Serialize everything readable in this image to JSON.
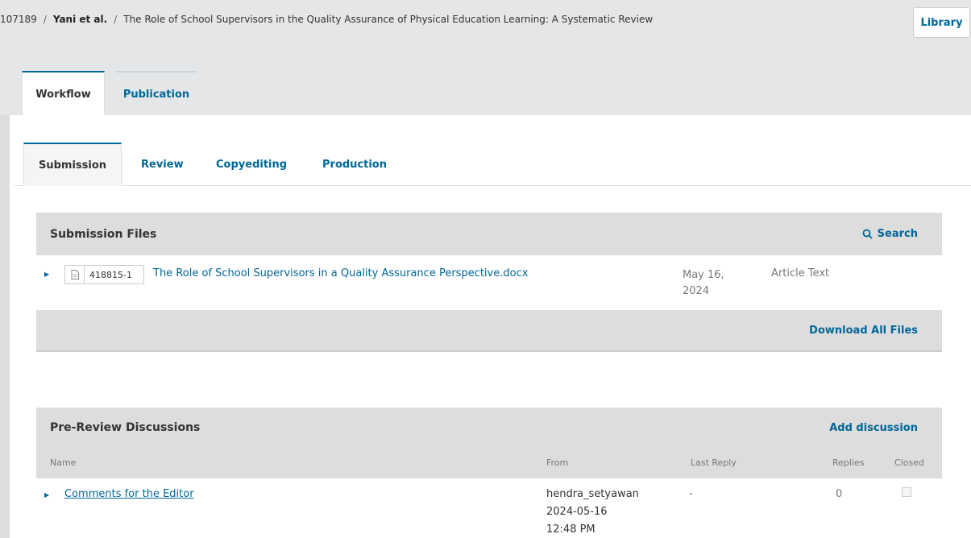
{
  "breadcrumb": {
    "id": "107189",
    "author": "Yani et al.",
    "title": "The Role of School Supervisors in the Quality Assurance of Physical Education Learning: A Systematic Review",
    "separator": "/"
  },
  "header": {
    "library_label": "Library"
  },
  "top_tabs": [
    {
      "label": "Workflow",
      "active": true
    },
    {
      "label": "Publication",
      "active": false
    }
  ],
  "stage_tabs": [
    {
      "label": "Submission",
      "active": true
    },
    {
      "label": "Review",
      "active": false
    },
    {
      "label": "Copyediting",
      "active": false
    },
    {
      "label": "Production",
      "active": false
    }
  ],
  "submission_files": {
    "title": "Submission Files",
    "search_label": "Search",
    "search_icon": "search-icon",
    "files": [
      {
        "id": "418815-1",
        "name": "The Role of School Supervisors in a Quality Assurance Perspective.docx",
        "date": "May 16, 2024",
        "type": "Article Text"
      }
    ],
    "download_all_label": "Download All Files"
  },
  "discussions": {
    "title": "Pre-Review Discussions",
    "add_label": "Add discussion",
    "columns": {
      "name": "Name",
      "from": "From",
      "last_reply": "Last Reply",
      "replies": "Replies",
      "closed": "Closed"
    },
    "rows": [
      {
        "name": "Comments for the Editor",
        "from_user": "hendra_setyawan",
        "from_date": "2024-05-16 12:48 PM",
        "last_reply": "-",
        "replies": "0",
        "closed": false
      }
    ]
  },
  "colors": {
    "link": "#006798",
    "header_bg": "#e4e6e7",
    "grid_bg": "#dddddd"
  }
}
